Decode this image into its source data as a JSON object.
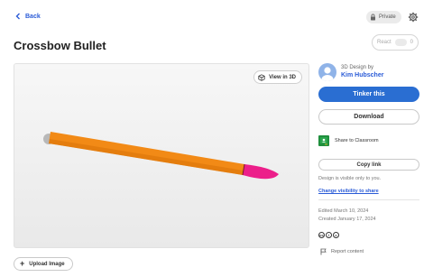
{
  "nav": {
    "back_label": "Back"
  },
  "header": {
    "privacy_label": "Private",
    "title": "Crossbow Bullet"
  },
  "react": {
    "label": "React",
    "count": "0"
  },
  "viewer": {
    "view3d_label": "View in 3D",
    "model_colors": {
      "body": "#f28a16",
      "tip": "#ec1f8a",
      "background": "#ededed"
    }
  },
  "upload": {
    "label": "Upload Image"
  },
  "author": {
    "label": "3D Design by",
    "name": "Kim Hubscher"
  },
  "actions": {
    "tinker_label": "Tinker this",
    "download_label": "Download",
    "classroom_label": "Share to Classroom",
    "copy_link_label": "Copy link",
    "visibility_text": "Design is visible only to you.",
    "change_visibility_label": "Change visibility to share"
  },
  "meta": {
    "edited": "Edited March 10, 2024",
    "created": "Created January 17, 2024",
    "report_label": "Report content"
  },
  "colors": {
    "accent": "#2a6ed2",
    "link": "#2a5bd7"
  }
}
